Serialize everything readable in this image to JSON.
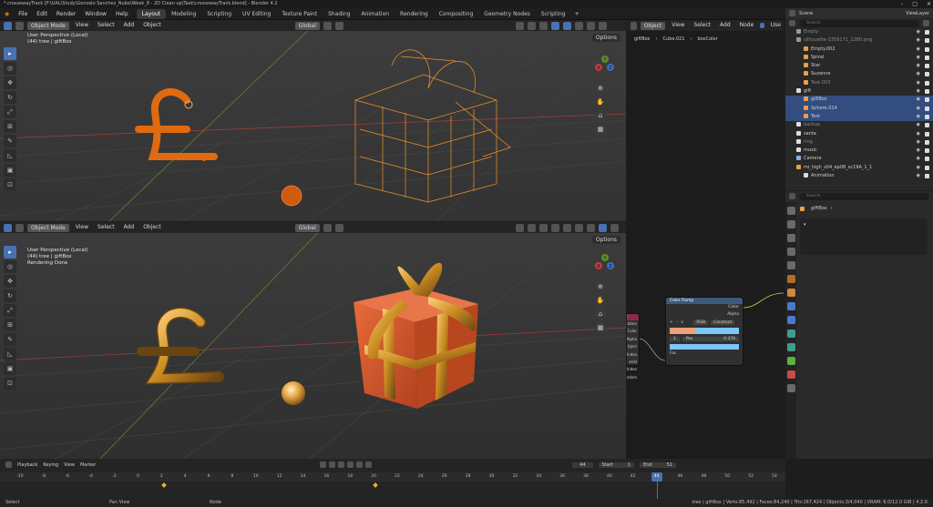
{
  "window": {
    "title": "*.crossewayTrack [F:\\UAL\\Study\\Gonzalo Sanchez_Nube\\Week_8 - 2D Clean up\\Task\\crossewayTrack.blend] - Blender 4.2",
    "controls": [
      "–",
      "□",
      "✕"
    ]
  },
  "menu": [
    "File",
    "Edit",
    "Render",
    "Window",
    "Help"
  ],
  "workspaces": [
    "Layout",
    "Modeling",
    "Scripting",
    "UV Editing",
    "Texture Paint",
    "Shading",
    "Animation",
    "Rendering",
    "Compositing",
    "Geometry Nodes",
    "Scripting"
  ],
  "workspace_add": "+",
  "top_viewport": {
    "mode": "Object Mode",
    "menu": [
      "View",
      "Select",
      "Add",
      "Object"
    ],
    "transform": "Global",
    "options": "Options",
    "overlay": [
      "User Perspective (Local)",
      "(44) tree | giftBox"
    ]
  },
  "bottom_viewport": {
    "mode": "Object Mode",
    "menu": [
      "View",
      "Select",
      "Add",
      "Object"
    ],
    "transform": "Global",
    "options": "Options",
    "overlay": [
      "User Perspective (Local)",
      "(44) tree | giftBox",
      "Rendering Done"
    ]
  },
  "gizmo": {
    "x": "X",
    "y": "Y",
    "z": "Z"
  },
  "node_editor": {
    "mode": "Object",
    "menu": [
      "View",
      "Select",
      "Add",
      "Node"
    ],
    "use_nodes": "Use",
    "breadcrumb": [
      "giftBox",
      "Cube.021",
      "boxColor"
    ],
    "input_node": {
      "title": "tix",
      "outputs": [
        "Location",
        "Color",
        "Alpha",
        "bject Index",
        "erial Index",
        "Random"
      ]
    },
    "ramp_node": {
      "title": "Color Ramp",
      "outputs": [
        "Color",
        "Alpha"
      ],
      "mode": "RGB",
      "interp": "Constant",
      "index": "1",
      "pos_label": "Pos",
      "pos_value": "0.378",
      "input": "Fac",
      "ramp_controls": [
        "+",
        "–",
        "∨"
      ]
    }
  },
  "outliner": {
    "title": "Scene",
    "view_layer": "ViewLayer",
    "search_placeholder": "Search",
    "rows": [
      {
        "label": "Empty",
        "dim": true
      },
      {
        "label": "silhouette-3359171_1280.png",
        "dim": true
      },
      {
        "label": "Empty.002"
      },
      {
        "label": "Spiral"
      },
      {
        "label": "Star"
      },
      {
        "label": "Suzanne"
      },
      {
        "label": "Text.003",
        "dim": true
      },
      {
        "label": "gift"
      },
      {
        "label": "giftBox",
        "sel": true
      },
      {
        "label": "Sphere.014",
        "sel": true
      },
      {
        "label": "Text",
        "sel": true
      },
      {
        "label": "backup",
        "dim": true
      },
      {
        "label": "santa"
      },
      {
        "label": "ring",
        "dim": true
      },
      {
        "label": "music"
      },
      {
        "label": "Camera"
      },
      {
        "label": "mi_high_s04_ep08_sc19A_1_1"
      },
      {
        "label": "Animation"
      }
    ]
  },
  "properties": {
    "search_placeholder": "Search",
    "object_name": "giftBox"
  },
  "timeline": {
    "menu": [
      "Playback",
      "Keying",
      "View",
      "Marker"
    ],
    "current_frame": "44",
    "start_label": "Start",
    "start": "1",
    "end_label": "End",
    "end": "51",
    "ticks": [
      "-10",
      "-8",
      "-6",
      "-4",
      "-2",
      "0",
      "2",
      "4",
      "6",
      "8",
      "10",
      "12",
      "14",
      "16",
      "18",
      "20",
      "22",
      "24",
      "26",
      "28",
      "30",
      "32",
      "34",
      "36",
      "38",
      "40",
      "42",
      "44",
      "46",
      "48",
      "50",
      "52",
      "54"
    ]
  },
  "status": {
    "left": [
      "Select",
      "Pan View",
      "Node"
    ],
    "right": "tree | giftBox | Verts:85,492 | Faces:84,240 | Tris:167,424 | Objects:3/4,040 | VRAM: 6.0/12.0 GiB | 4.2.0"
  }
}
